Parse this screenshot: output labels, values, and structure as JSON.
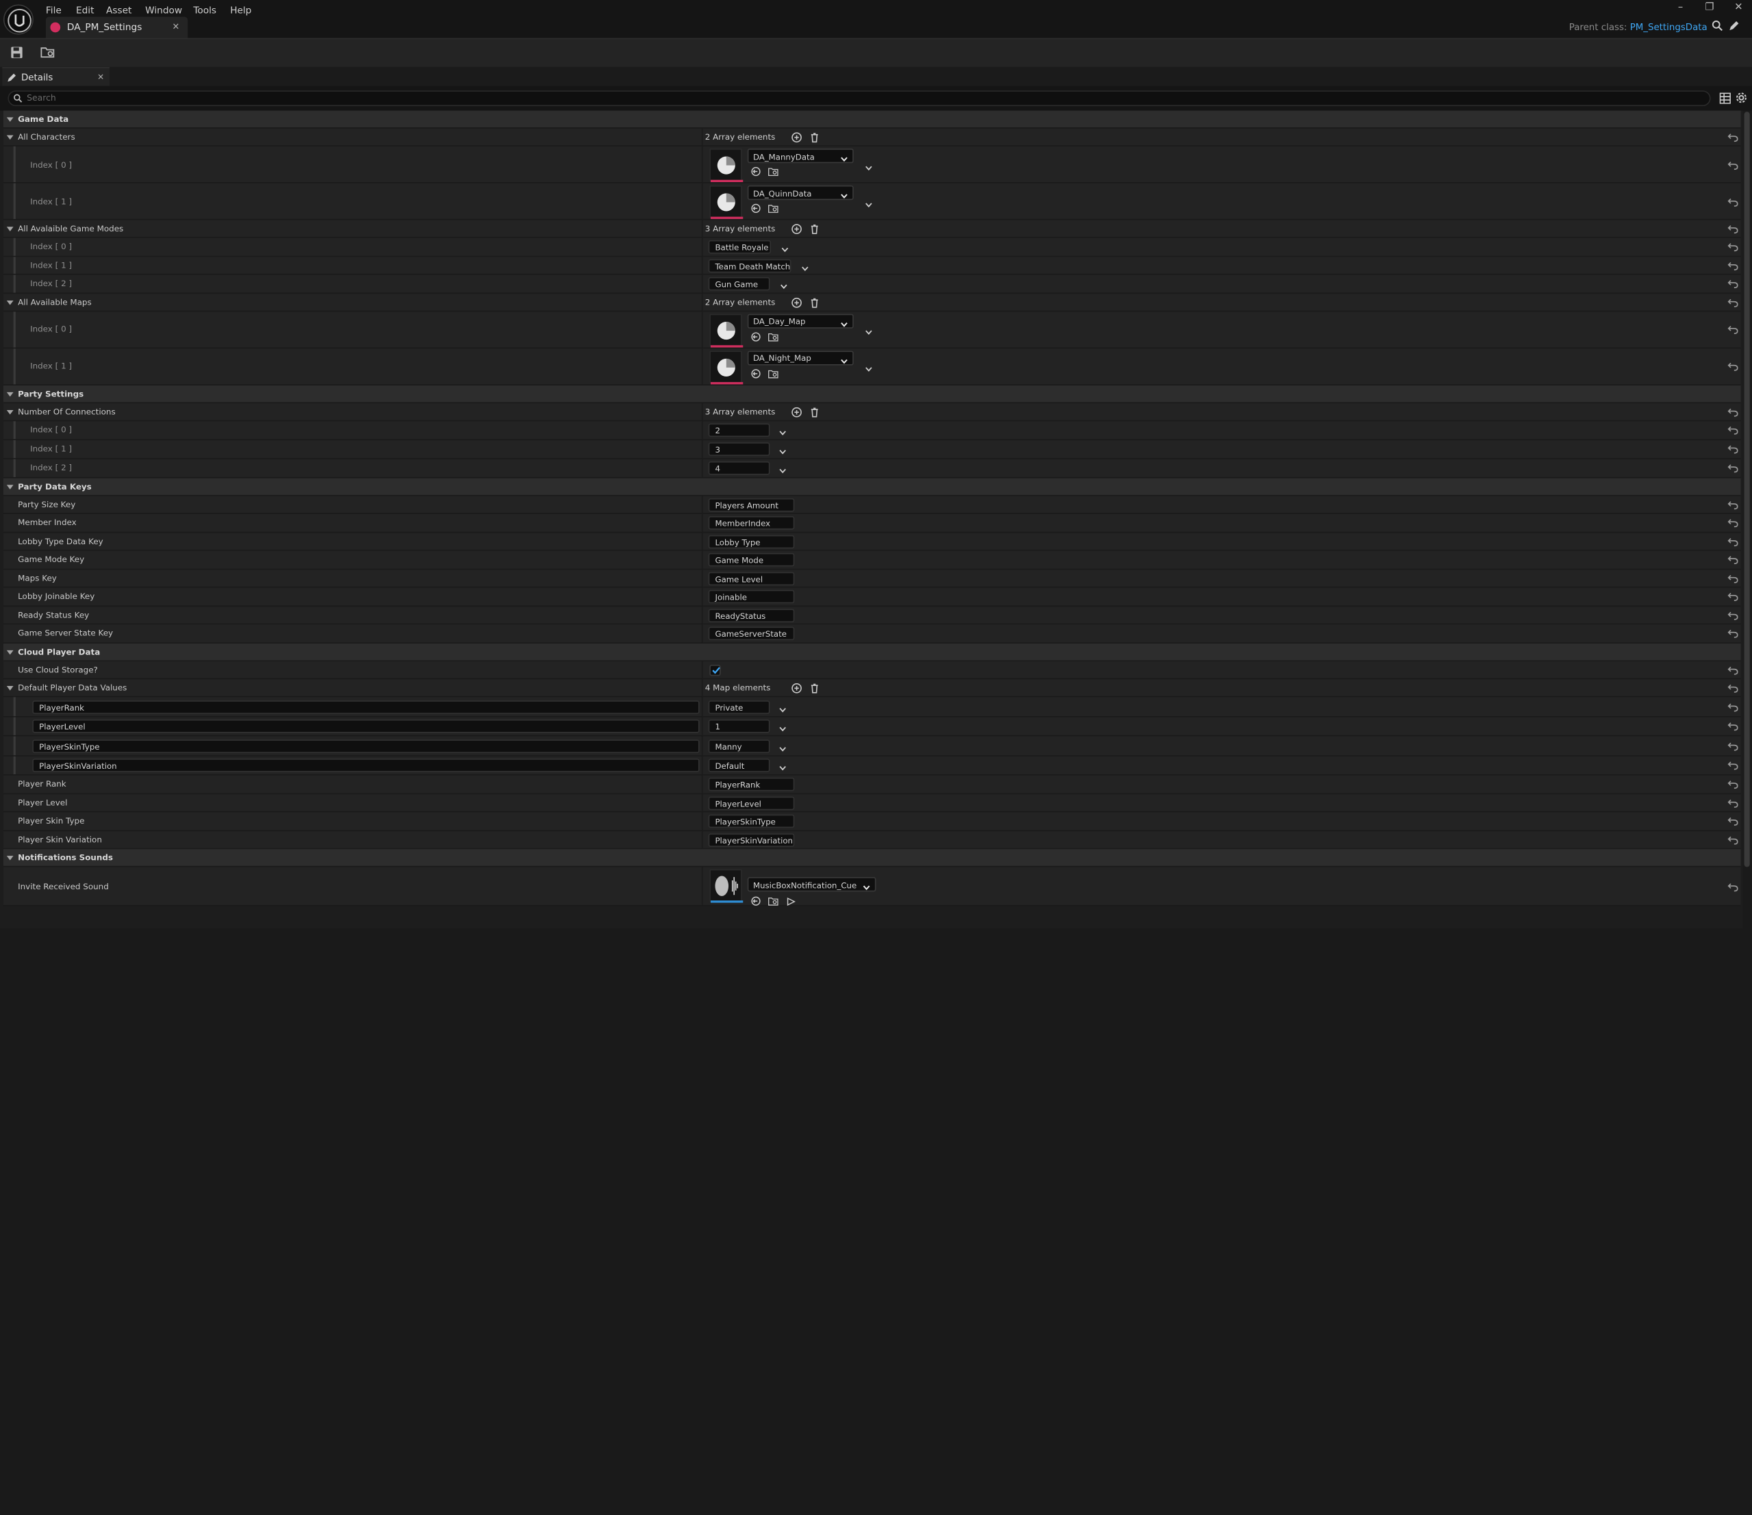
{
  "menubar": {
    "items": [
      "File",
      "Edit",
      "Asset",
      "Window",
      "Tools",
      "Help"
    ]
  },
  "tab": {
    "title": "DA_PM_Settings",
    "close": "×"
  },
  "header": {
    "parent_label": "Parent class:",
    "parent_value": "PM_SettingsData"
  },
  "details": {
    "title": "Details",
    "close": "×",
    "search_placeholder": "Search"
  },
  "colors": {
    "accent_pink": "#d22e5f",
    "link_blue": "#3fa6f2",
    "sound_blue": "#2f8fd6"
  },
  "rows": [
    {
      "kind": "cat",
      "label": "Game Data"
    },
    {
      "kind": "array",
      "label": "All Characters",
      "value": "2 Array elements"
    },
    {
      "kind": "asset",
      "label": "Index [ 0 ]",
      "value": "DA_MannyData"
    },
    {
      "kind": "asset",
      "label": "Index [ 1 ]",
      "value": "DA_QuinnData"
    },
    {
      "kind": "array",
      "label": "All Avalaible Game Modes",
      "value": "3 Array elements"
    },
    {
      "kind": "combo",
      "label": "Index [ 0 ]",
      "value": "Battle Royale",
      "w": 56
    },
    {
      "kind": "combo",
      "label": "Index [ 1 ]",
      "value": "Team Death Match",
      "w": 74
    },
    {
      "kind": "combo",
      "label": "Index [ 2 ]",
      "value": "Gun Game",
      "w": 55
    },
    {
      "kind": "array",
      "label": "All Available Maps",
      "value": "2 Array elements"
    },
    {
      "kind": "asset",
      "label": "Index [ 0 ]",
      "value": "DA_Day_Map"
    },
    {
      "kind": "asset",
      "label": "Index [ 1 ]",
      "value": "DA_Night_Map"
    },
    {
      "kind": "cat",
      "label": "Party Settings"
    },
    {
      "kind": "array",
      "label": "Number Of Connections",
      "value": "3 Array elements"
    },
    {
      "kind": "num",
      "label": "Index [ 0 ]",
      "value": "2"
    },
    {
      "kind": "num",
      "label": "Index [ 1 ]",
      "value": "3"
    },
    {
      "kind": "num",
      "label": "Index [ 2 ]",
      "value": "4"
    },
    {
      "kind": "cat",
      "label": "Party Data Keys"
    },
    {
      "kind": "text",
      "label": "Party Size Key",
      "value": "Players Amount"
    },
    {
      "kind": "text",
      "label": "Member Index",
      "value": "MemberIndex"
    },
    {
      "kind": "text",
      "label": "Lobby Type Data Key",
      "value": "Lobby Type"
    },
    {
      "kind": "text",
      "label": "Game Mode Key",
      "value": "Game Mode"
    },
    {
      "kind": "text",
      "label": "Maps Key",
      "value": "Game Level"
    },
    {
      "kind": "text",
      "label": "Lobby Joinable Key",
      "value": "Joinable"
    },
    {
      "kind": "text",
      "label": "Ready Status Key",
      "value": "ReadyStatus"
    },
    {
      "kind": "text",
      "label": "Game Server State Key",
      "value": "GameServerState"
    },
    {
      "kind": "cat",
      "label": "Cloud Player Data"
    },
    {
      "kind": "check",
      "label": "Use Cloud Storage?",
      "value": "✓"
    },
    {
      "kind": "array",
      "label": "Default Player Data Values",
      "value": "4 Map elements"
    },
    {
      "kind": "map",
      "label": "PlayerRank",
      "value": "Private"
    },
    {
      "kind": "map",
      "label": "PlayerLevel",
      "value": "1"
    },
    {
      "kind": "map",
      "label": "PlayerSkinType",
      "value": "Manny"
    },
    {
      "kind": "map",
      "label": "PlayerSkinVariation",
      "value": "Default"
    },
    {
      "kind": "text",
      "label": "Player Rank",
      "value": "PlayerRank"
    },
    {
      "kind": "text",
      "label": "Player Level",
      "value": "PlayerLevel"
    },
    {
      "kind": "text",
      "label": "Player Skin Type",
      "value": "PlayerSkinType"
    },
    {
      "kind": "text",
      "label": "Player Skin Variation",
      "value": "PlayerSkinVariation"
    },
    {
      "kind": "cat",
      "label": "Notifications Sounds"
    },
    {
      "kind": "sound",
      "label": "Invite Received Sound",
      "value": "MusicBoxNotification_Cue"
    }
  ]
}
